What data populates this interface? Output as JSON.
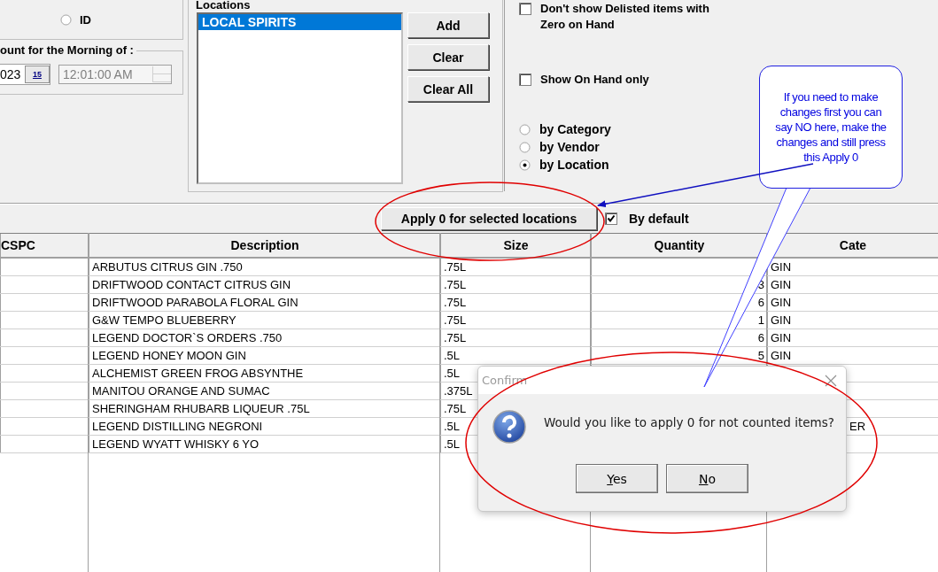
{
  "filters": {
    "id_radio": {
      "label": "ID",
      "selected": false
    },
    "count_group": {
      "label": "ount for the Morning of :",
      "date": "023",
      "calendar_button": "15",
      "time": "12:01:00 AM"
    }
  },
  "locations": {
    "label": "Locations",
    "items": [
      {
        "label": "LOCAL SPIRITS",
        "selected": true
      }
    ],
    "buttons": [
      "Add",
      "Clear",
      "Clear All"
    ]
  },
  "options": {
    "checkboxes": [
      {
        "label": "Don't show Delisted items with Zero on Hand",
        "checked": false
      },
      {
        "label": "Show On Hand only",
        "checked": false
      }
    ],
    "radios": [
      {
        "label": "by Category",
        "selected": false
      },
      {
        "label": "by Vendor",
        "selected": false
      },
      {
        "label": "by Location",
        "selected": true
      }
    ]
  },
  "toolbar": {
    "apply_button": "Apply 0 for selected locations",
    "by_default": {
      "label": "By default",
      "checked": true
    }
  },
  "table": {
    "columns": [
      "CSPC",
      "Description",
      "Size",
      "Quantity",
      "Cate"
    ],
    "rows": [
      {
        "description": "ARBUTUS CITRUS GIN .750",
        "size": ".75L",
        "category": "GIN"
      },
      {
        "description": "DRIFTWOOD CONTACT CITRUS GIN",
        "size": ".75L",
        "quantity": "3",
        "category": "GIN"
      },
      {
        "description": "DRIFTWOOD PARABOLA FLORAL GIN",
        "size": ".75L",
        "quantity": "6",
        "category": "GIN"
      },
      {
        "description": "G&W TEMPO BLUEBERRY",
        "size": ".75L",
        "quantity": "1",
        "category": "GIN"
      },
      {
        "description": "LEGEND DOCTOR`S ORDERS .750",
        "size": ".75L",
        "quantity": "6",
        "category": "GIN"
      },
      {
        "description": "LEGEND HONEY MOON GIN",
        "size": ".5L",
        "quantity": "5",
        "category": "GIN"
      },
      {
        "description": "ALCHEMIST GREEN FROG ABSYNTHE",
        "size": ".5L"
      },
      {
        "description": "MANITOU ORANGE AND SUMAC",
        "size": ".375L"
      },
      {
        "description": "SHERINGHAM RHUBARB LIQUEUR .75L",
        "size": ".75L"
      },
      {
        "description": "LEGEND DISTILLING NEGRONI",
        "size": ".5L",
        "category": "ER",
        "category_clipped": true
      },
      {
        "description": "LEGEND WYATT WHISKY 6 YO",
        "size": ".5L"
      }
    ]
  },
  "dialog": {
    "title": "Confirm",
    "message": "Would you like to apply 0 for not counted items?",
    "buttons": [
      {
        "label": "Yes",
        "underlined_first": true
      },
      {
        "label": "No",
        "underlined_first": true
      }
    ]
  },
  "annotation": {
    "callout": "If you need to make changes first you can say NO here, make the changes and still press this Apply 0"
  }
}
